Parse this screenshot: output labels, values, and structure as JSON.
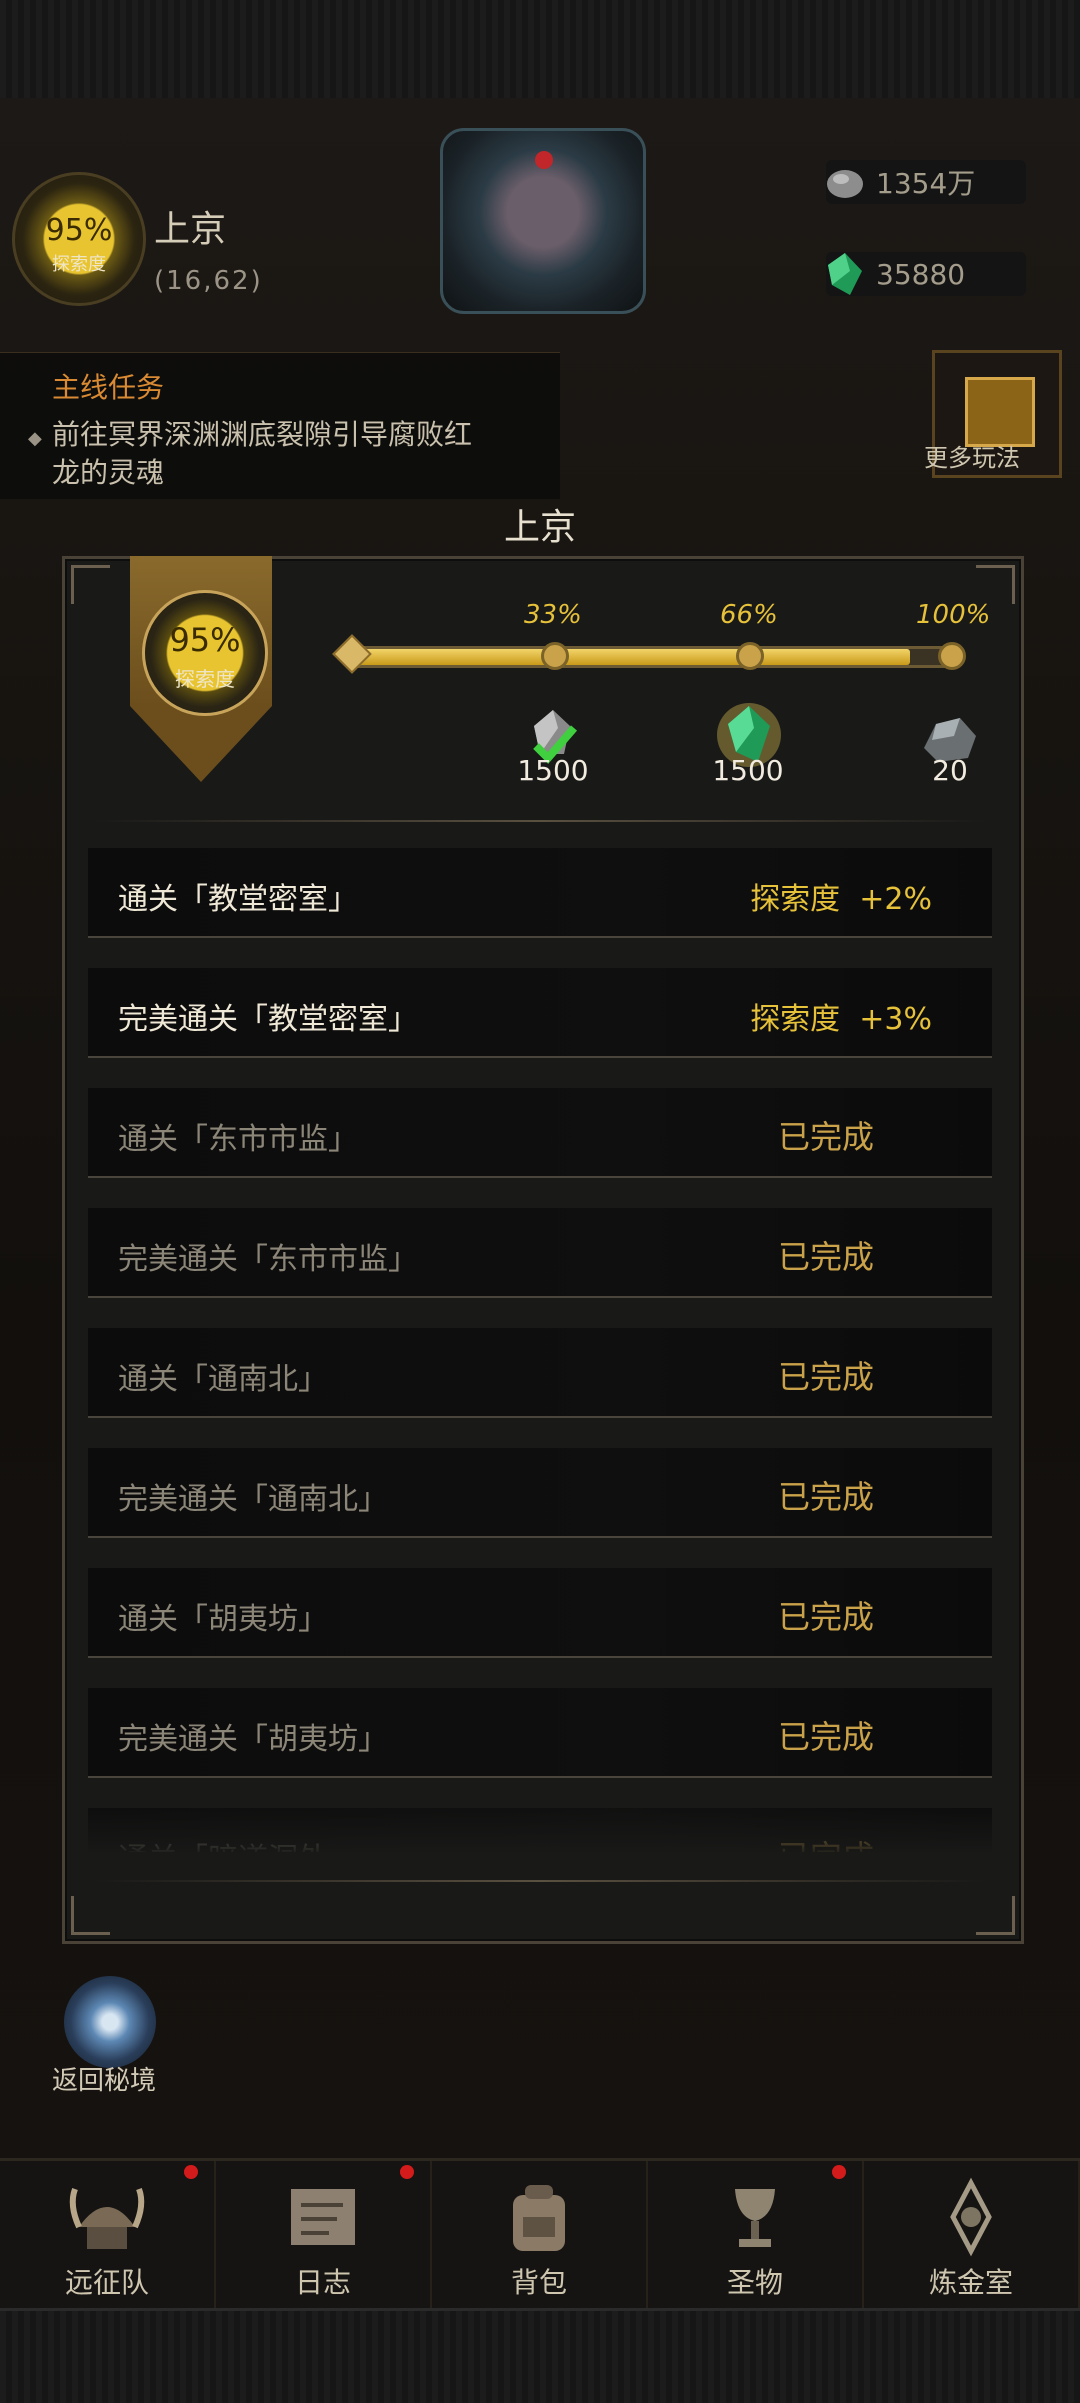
{
  "header": {
    "exploration_percent": "95%",
    "exploration_label": "探索度",
    "city_name": "上京",
    "coordinates": "(16,62)",
    "resources": [
      {
        "icon": "silver-ore-icon",
        "value": "1354万"
      },
      {
        "icon": "green-crystal-icon",
        "value": "35880"
      }
    ]
  },
  "main_quest": {
    "title": "主线任务",
    "text": "前往冥界深渊渊底裂隙引导腐败红龙的灵魂"
  },
  "side_buttons": {
    "more_play_label": "更多玩法"
  },
  "panel": {
    "title": "上京",
    "exploration_percent": "95%",
    "exploration_label": "探索度",
    "progress_fraction": 0.95,
    "milestones": [
      {
        "label": "33%",
        "reward_icon": "silver-ore-icon",
        "reward_count": "1500",
        "claimed": true
      },
      {
        "label": "66%",
        "reward_icon": "green-crystal-icon",
        "reward_count": "1500",
        "claimed": false
      },
      {
        "label": "100%",
        "reward_icon": "iron-ore-icon",
        "reward_count": "20",
        "claimed": false
      }
    ],
    "tasks": [
      {
        "name": "通关「教堂密室」",
        "status": "探索度  +2%",
        "done": false
      },
      {
        "name": "完美通关「教堂密室」",
        "status": "探索度  +3%",
        "done": false
      },
      {
        "name": "通关「东市市监」",
        "status": "已完成",
        "done": true
      },
      {
        "name": "完美通关「东市市监」",
        "status": "已完成",
        "done": true
      },
      {
        "name": "通关「通南北」",
        "status": "已完成",
        "done": true
      },
      {
        "name": "完美通关「通南北」",
        "status": "已完成",
        "done": true
      },
      {
        "name": "通关「胡夷坊」",
        "status": "已完成",
        "done": true
      },
      {
        "name": "完美通关「胡夷坊」",
        "status": "已完成",
        "done": true
      },
      {
        "name": "通关「暗道洞外」",
        "status": "已完成",
        "done": true
      }
    ]
  },
  "return_portal_label": "返回秘境",
  "nav": [
    {
      "label": "远征队",
      "icon": "viking-helmet-icon",
      "badge": true
    },
    {
      "label": "日志",
      "icon": "scroll-map-icon",
      "badge": true
    },
    {
      "label": "背包",
      "icon": "backpack-icon",
      "badge": false
    },
    {
      "label": "圣物",
      "icon": "chalice-icon",
      "badge": true
    },
    {
      "label": "炼金室",
      "icon": "alchemy-icon",
      "badge": false
    }
  ],
  "colors": {
    "accent_gold": "#e6c13a",
    "done_gold": "#c9a24a",
    "quest_orange": "#d98a32",
    "notify_red": "#d41b1b"
  }
}
